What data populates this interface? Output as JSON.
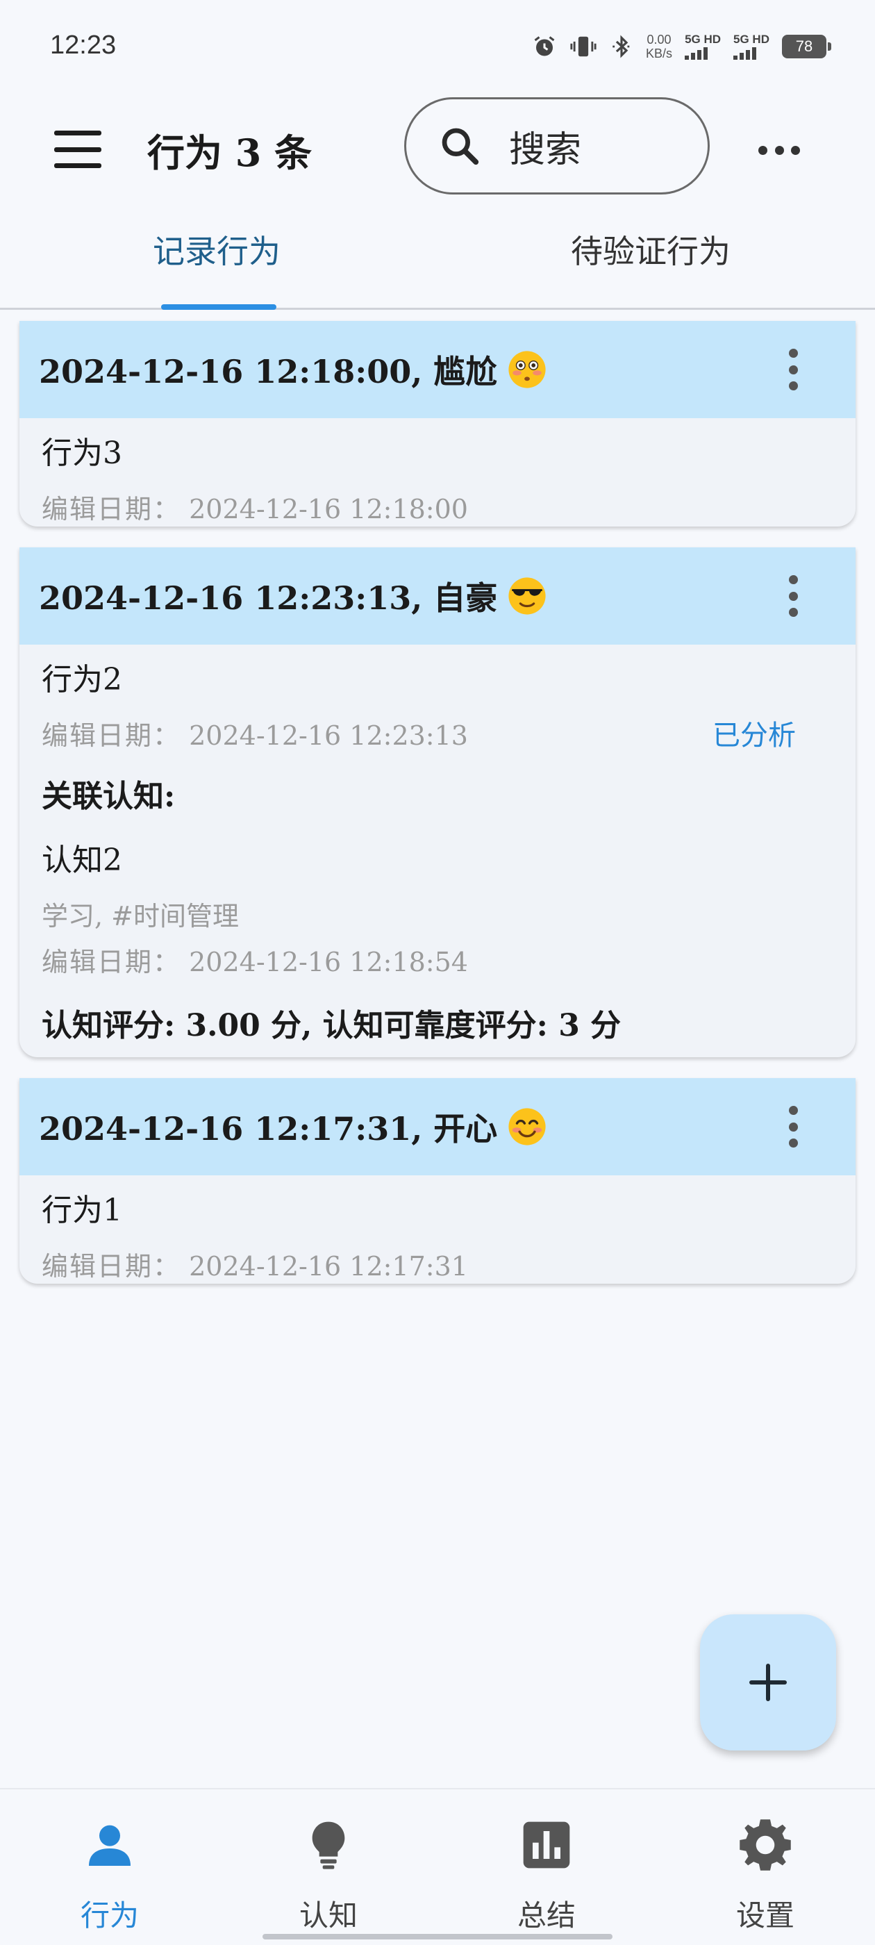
{
  "status_bar": {
    "time": "12:23",
    "speed_value": "0.00",
    "speed_unit": "KB/s",
    "sim1": "5G HD",
    "sim2": "5G HD",
    "battery": "78",
    "icons": [
      "alarm-icon",
      "vibrate-icon",
      "bluetooth-icon"
    ]
  },
  "app_bar": {
    "title": "行为 3 条",
    "search_placeholder": "搜索"
  },
  "tabs": [
    {
      "label": "记录行为",
      "active": true
    },
    {
      "label": "待验证行为",
      "active": false
    }
  ],
  "cards": [
    {
      "header": "2024-12-16 12:18:00, 尴尬",
      "emoji": "flushed-face",
      "behavior": "行为3",
      "edit_label": "编辑日期：",
      "edit_date": "2024-12-16 12:18:00"
    },
    {
      "header": "2024-12-16 12:23:13, 自豪",
      "emoji": "sunglasses-face",
      "behavior": "行为2",
      "edit_label": "编辑日期：",
      "edit_date": "2024-12-16 12:23:13",
      "status": "已分析",
      "related_heading": "关联认知:",
      "cognition": "认知2",
      "tags": "学习, #时间管理",
      "cog_edit_label": "编辑日期：",
      "cog_edit_date": "2024-12-16 12:18:54",
      "scores": "认知评分: 3.00 分, 认知可靠度评分: 3 分"
    },
    {
      "header": "2024-12-16 12:17:31, 开心",
      "emoji": "smiling-face",
      "behavior": "行为1",
      "edit_label": "编辑日期：",
      "edit_date": "2024-12-16 12:17:31"
    }
  ],
  "bottom_nav": [
    {
      "label": "行为",
      "icon": "person-icon",
      "active": true
    },
    {
      "label": "认知",
      "icon": "lightbulb-icon",
      "active": false
    },
    {
      "label": "总结",
      "icon": "bar-chart-icon",
      "active": false
    },
    {
      "label": "设置",
      "icon": "gear-icon",
      "active": false
    }
  ],
  "colors": {
    "accent": "#2787d6",
    "card_header": "#c4e6fb",
    "fab": "#c9e6fc"
  }
}
